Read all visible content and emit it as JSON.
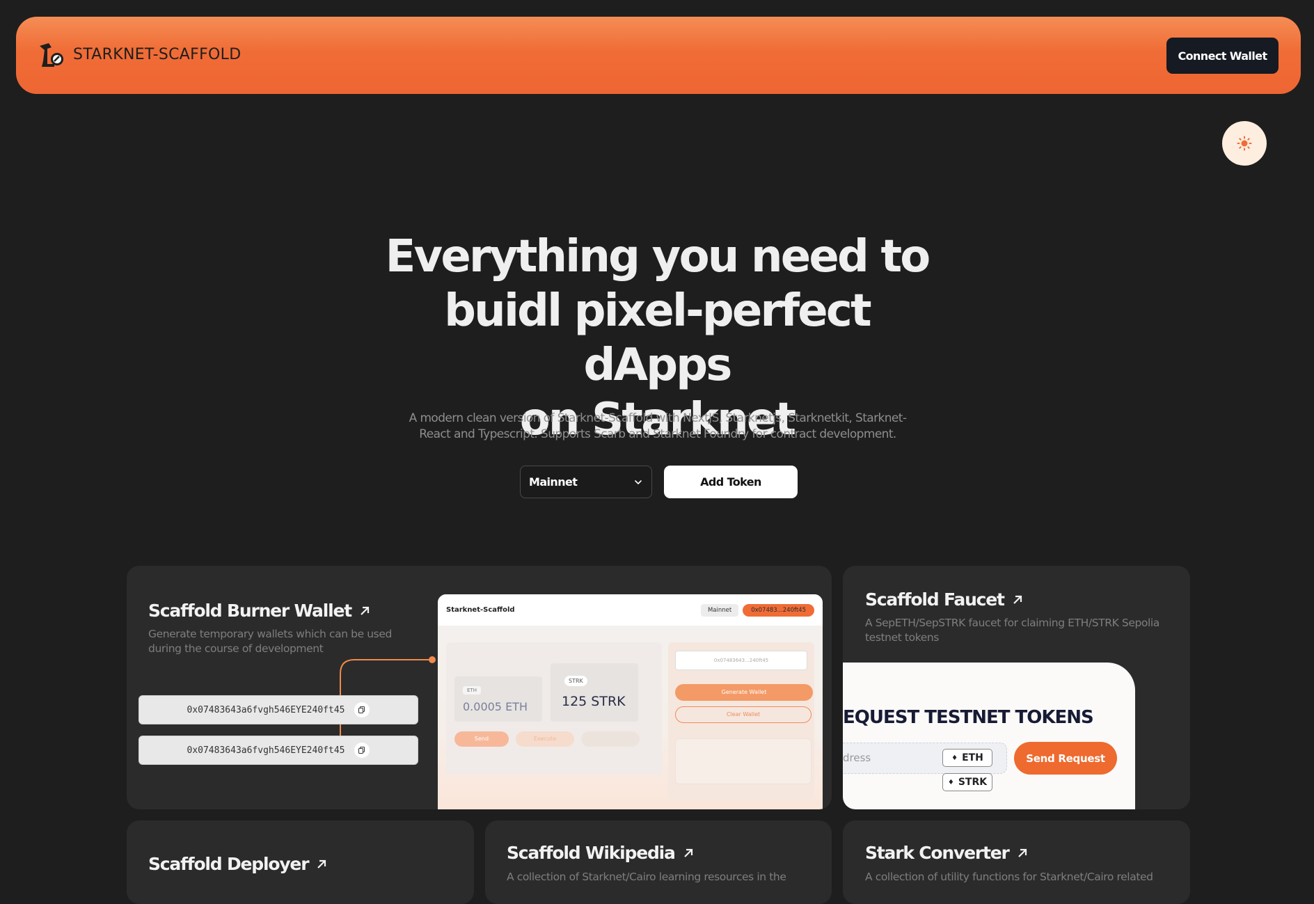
{
  "header": {
    "brand": "STARKNET-SCAFFOLD",
    "connect_label": "Connect Wallet"
  },
  "theme_toggle_icon": "sun-icon",
  "hero": {
    "title_line1": "Everything you need to",
    "title_line2": "buidl pixel-perfect dApps",
    "title_line3": "on Starknet",
    "subtitle_line1": "A modern clean version of Starknet-Scaffold with NextJS, Starknetjs, Starknetkit, Starknet-",
    "subtitle_line2": "React and Typescript. Supports Scarb and Starknet Foundry for contract development."
  },
  "controls": {
    "network_selected": "Mainnet",
    "add_token_label": "Add Token"
  },
  "cards": {
    "burner": {
      "title": "Scaffold Burner Wallet",
      "desc": "Generate temporary wallets which can be used during the course of development",
      "addresses": [
        "0x07483643a6fvgh546EYE240ft45",
        "0x07483643a6fvgh546EYE240ft45"
      ],
      "mock": {
        "brand": "Starknet-Scaffold",
        "network": "Mainnet",
        "address": "0x07483...240ft45",
        "eth_label": "ETH",
        "eth_value": "0.0005 ETH",
        "strk_label": "STRK",
        "strk_value": "125 STRK",
        "send": "Send",
        "execute": "Execute",
        "addr_field": "0x07483643...240ft45",
        "generate": "Generate Wallet",
        "clear": "Clear Wallet"
      }
    },
    "faucet": {
      "title": "Scaffold Faucet",
      "desc": "A SepETH/SepSTRK faucet for claiming ETH/STRK Sepolia testnet tokens",
      "request_title": "EQUEST TESTNET TOKENS",
      "input_placeholder": "dress",
      "eth": "ETH",
      "strk": "STRK",
      "send_request": "Send Request"
    },
    "deployer": {
      "title": "Scaffold Deployer"
    },
    "wikipedia": {
      "title": "Scaffold Wikipedia",
      "desc": "A collection of Starknet/Cairo learning resources in the"
    },
    "converter": {
      "title": "Stark Converter",
      "desc": "A collection of utility functions for Starknet/Cairo related"
    }
  }
}
